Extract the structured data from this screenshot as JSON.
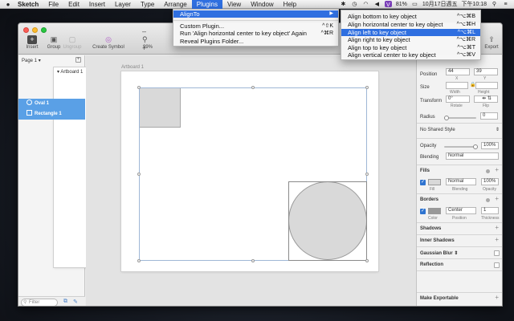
{
  "menubar": {
    "apple": "",
    "items": [
      "Sketch",
      "File",
      "Edit",
      "Insert",
      "Layer",
      "Type",
      "Arrange",
      "Plugins",
      "View",
      "Window",
      "Help"
    ],
    "status": {
      "battery": "81%",
      "date": "10月17日週五",
      "time": "下午10:18"
    }
  },
  "window": {
    "toolbar": {
      "insert": "Insert",
      "group": "Group",
      "ungroup": "Ungroup",
      "create_symbol": "Create Symbol",
      "zoom": "99%",
      "export": "Export"
    },
    "layers": {
      "page": "Page 1",
      "artboard": "Artboard 1",
      "items": [
        "Oval 1",
        "Rectangle 1"
      ],
      "filter_placeholder": "Filter"
    },
    "canvas": {
      "artboard_label": "Artboard 1"
    },
    "inspector": {
      "position_label": "Position",
      "x": "44",
      "y": "39",
      "x_label": "X",
      "y_label": "Y",
      "size_label": "Size",
      "width_label": "Width",
      "height_label": "Height",
      "transform_label": "Transform",
      "rotate_value": "0°",
      "rotate_label": "Rotate",
      "flip_label": "Flip",
      "radius_label": "Radius",
      "radius_value": "0",
      "style": "No Shared Style",
      "opacity_label": "Opacity",
      "opacity_value": "100%",
      "blending_label": "Blending",
      "blending_value": "Normal",
      "fills_label": "Fills",
      "fill_blend": "Normal",
      "fill_opacity": "100%",
      "fill_sub": "Fill",
      "fill_blending_sub": "Blending",
      "fill_opacity_sub": "Opacity",
      "borders_label": "Borders",
      "border_position": "Center",
      "border_thickness": "1",
      "border_color_sub": "Color",
      "border_position_sub": "Position",
      "border_thickness_sub": "Thickness",
      "shadows": "Shadows",
      "inner_shadows": "Inner Shadows",
      "gaussian_blur": "Gaussian Blur",
      "reflection": "Reflection",
      "make_exportable": "Make Exportable"
    }
  },
  "plugins_menu": {
    "items": [
      {
        "label": "AlignTo",
        "shortcut": "",
        "submenu": true
      },
      {
        "label": "Custom Plugin...",
        "shortcut": "^⇧K"
      },
      {
        "label": "Run 'Align horizontal center to key object' Again",
        "shortcut": "^⌘R"
      },
      {
        "label": "Reveal Plugins Folder...",
        "shortcut": ""
      }
    ]
  },
  "alignto_menu": {
    "items": [
      {
        "label": "Align bottom to key object",
        "shortcut": "^⌥⌘B"
      },
      {
        "label": "Align horizontal center to key object",
        "shortcut": "^⌥⌘H"
      },
      {
        "label": "Align left to key object",
        "shortcut": "^⌥⌘L"
      },
      {
        "label": "Align right to key object",
        "shortcut": "^⌥⌘R"
      },
      {
        "label": "Align top to key object",
        "shortcut": "^⌥⌘T"
      },
      {
        "label": "Align vertical center to key object",
        "shortcut": "^⌥⌘V"
      }
    ]
  },
  "colors": {
    "accent": "#2f6fe0",
    "layer_selected": "#5aa0e6",
    "shape_fill": "#d9d9d9"
  }
}
